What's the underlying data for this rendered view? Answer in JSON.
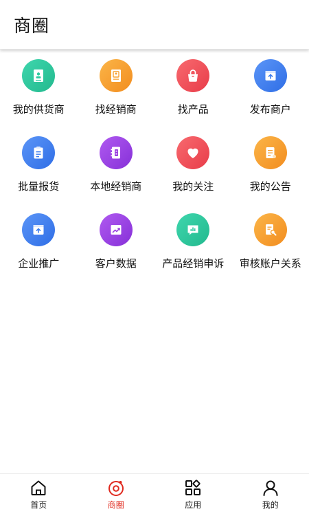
{
  "header": {
    "title": "商圈"
  },
  "grid": {
    "items": [
      {
        "label": "我的供货商",
        "icon": "book-contact-icon",
        "color": "#2ec9a0"
      },
      {
        "label": "找经销商",
        "icon": "contact-card-icon",
        "color": "#f7a233"
      },
      {
        "label": "找产品",
        "icon": "bag-icon",
        "color": "#f0535c"
      },
      {
        "label": "发布商户",
        "icon": "upload-box-icon",
        "color": "#3d7ef0"
      },
      {
        "label": "批量报货",
        "icon": "clipboard-icon",
        "color": "#3d7ef0"
      },
      {
        "label": "本地经销商",
        "icon": "address-book-icon",
        "color": "#9a3fe0"
      },
      {
        "label": "我的关注",
        "icon": "heart-icon",
        "color": "#f0535c"
      },
      {
        "label": "我的公告",
        "icon": "notice-icon",
        "color": "#f7a233"
      },
      {
        "label": "企业推广",
        "icon": "upload-box-icon",
        "color": "#3d7ef0"
      },
      {
        "label": "客户数据",
        "icon": "trend-chart-icon",
        "color": "#9a3fe0"
      },
      {
        "label": "产品经销申诉",
        "icon": "chat-chart-icon",
        "color": "#2ec9a0"
      },
      {
        "label": "审核账户关系",
        "icon": "search-doc-icon",
        "color": "#f7a233"
      }
    ]
  },
  "bottom_nav": {
    "items": [
      {
        "label": "首页",
        "icon": "home-icon"
      },
      {
        "label": "商圈",
        "icon": "circle-orbit-icon",
        "active": true
      },
      {
        "label": "应用",
        "icon": "apps-grid-icon"
      },
      {
        "label": "我的",
        "icon": "user-icon"
      }
    ],
    "active_color": "#e0291e"
  }
}
